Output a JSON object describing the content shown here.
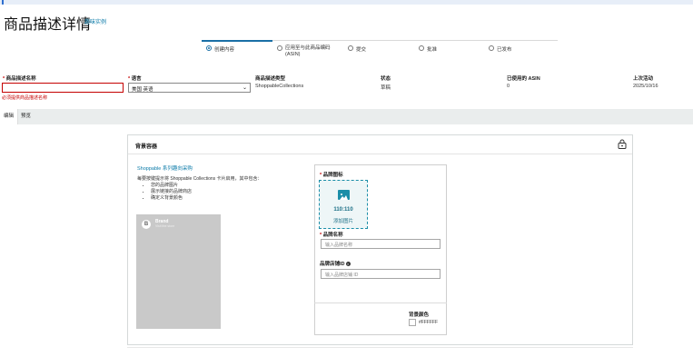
{
  "header": {
    "title": "商品描述详情",
    "link": "趣味实例"
  },
  "stepper": {
    "steps": [
      {
        "label": "创建内容",
        "active": true
      },
      {
        "label": "应用至与此商品编码 (ASIN)",
        "active": false
      },
      {
        "label": "提交",
        "active": false
      },
      {
        "label": "批准",
        "active": false
      },
      {
        "label": "已发布",
        "active": false
      }
    ]
  },
  "meta": {
    "name_label": "商品描述名称",
    "name_value": "",
    "name_error": "必须提供商品描述名称",
    "language_label": "语言",
    "language_value": "美国 英语",
    "type_label": "商品描述类型",
    "type_value": "ShoppableCollections",
    "status_label": "状态",
    "status_value": "草稿",
    "asin_label": "已使用的 ASIN",
    "asin_value": "0",
    "updated_label": "上次活动",
    "updated_value": "2025/10/16"
  },
  "tabs": [
    "编辑",
    "预览"
  ],
  "card": {
    "title": "背景容器",
    "collection_link": "Shoppable 系列趣向采购",
    "description": "每要按键提示将 Shoppable Collections 卡片启用，其中包含：",
    "bullets": [
      "您的品牌图片",
      "展示链接的品牌商店",
      "确定义背景颜色"
    ],
    "preview_brand": "Brand",
    "preview_sub": "Visit the store",
    "preview_logo": "B"
  },
  "form": {
    "logo_label": "品牌图标",
    "logo_size": "110:110",
    "logo_add": "添加图片",
    "brand_name_label": "品牌名称",
    "brand_name_placeholder": "输入品牌名称",
    "store_link_label": "品牌店铺ID",
    "store_link_placeholder": "输入品牌店铺 ID",
    "bg_color_label": "背景颜色",
    "bg_color_value": "#FFFFFF"
  },
  "colors": {
    "accent": "#1a6fa6",
    "error": "#c40000",
    "teal": "#1b8ea8"
  }
}
